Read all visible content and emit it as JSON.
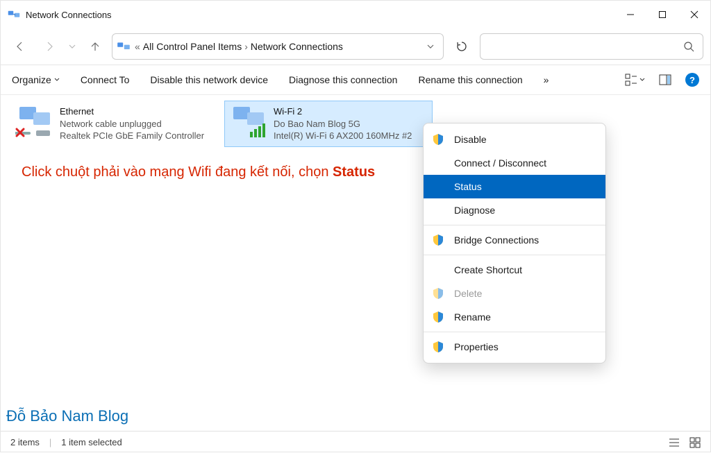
{
  "window": {
    "title": "Network Connections"
  },
  "breadcrumb": {
    "dots": "«",
    "item1": "All Control Panel Items",
    "item2": "Network Connections"
  },
  "toolbar": {
    "organize": "Organize",
    "connect": "Connect To",
    "disable": "Disable this network device",
    "diagnose": "Diagnose this connection",
    "rename": "Rename this connection",
    "more": "»"
  },
  "adapters": {
    "ethernet": {
      "name": "Ethernet",
      "status": "Network cable unplugged",
      "device": "Realtek PCIe GbE Family Controller"
    },
    "wifi": {
      "name": "Wi-Fi 2",
      "status": "Do Bao Nam Blog 5G",
      "device": "Intel(R) Wi-Fi 6 AX200 160MHz #2"
    }
  },
  "contextmenu": {
    "disable": "Disable",
    "connect": "Connect / Disconnect",
    "status": "Status",
    "diagnose": "Diagnose",
    "bridge": "Bridge Connections",
    "create_shortcut": "Create Shortcut",
    "delete": "Delete",
    "rename": "Rename",
    "properties": "Properties"
  },
  "annotation": {
    "pre": "Click chuột phải vào mạng Wifi đang kết nối, chọn ",
    "strong": "Status"
  },
  "watermark": "Đỗ Bảo Nam Blog",
  "statusbar": {
    "items": "2 items",
    "selected": "1 item selected"
  }
}
